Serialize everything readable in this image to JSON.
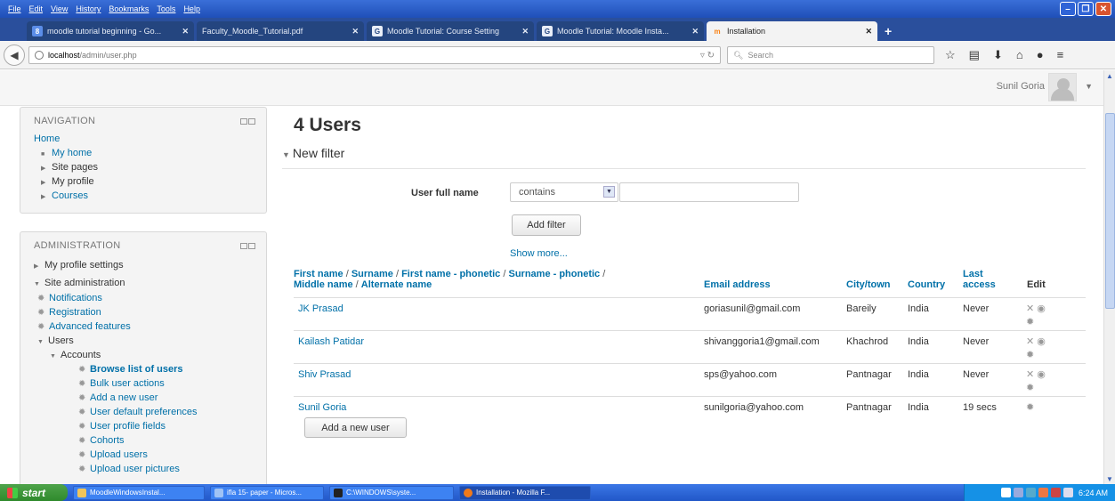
{
  "browser": {
    "menu": [
      "File",
      "Edit",
      "View",
      "History",
      "Bookmarks",
      "Tools",
      "Help"
    ],
    "tabs": [
      {
        "title": "moodle tutorial beginning - Go...",
        "icon": "google-icon",
        "icon_color": "#5b8de8",
        "active": false
      },
      {
        "title": "Faculty_Moodle_Tutorial.pdf",
        "icon": "pdf-icon",
        "icon_color": "#24457f",
        "active": false
      },
      {
        "title": "Moodle Tutorial: Course Setting",
        "icon": "g-icon",
        "icon_color": "#f3f3f3",
        "active": false
      },
      {
        "title": "Moodle Tutorial: Moodle Insta...",
        "icon": "g-icon",
        "icon_color": "#f3f3f3",
        "active": false
      },
      {
        "title": "Installation",
        "icon": "moodle-icon",
        "icon_color": "#f98012",
        "active": true
      }
    ],
    "url_host": "localhost",
    "url_path": "/admin/user.php",
    "search_placeholder": "Search"
  },
  "header": {
    "user_name": "Sunil Goria"
  },
  "navigation": {
    "title": "NAVIGATION",
    "home": "Home",
    "items": [
      "My home",
      "Site pages",
      "My profile",
      "Courses"
    ]
  },
  "administration": {
    "title": "ADMINISTRATION",
    "my_profile_settings": "My profile settings",
    "site_administration": "Site administration",
    "notifications": "Notifications",
    "registration": "Registration",
    "advanced_features": "Advanced features",
    "users": "Users",
    "accounts": "Accounts",
    "account_items": [
      "Browse list of users",
      "Bulk user actions",
      "Add a new user",
      "User default preferences",
      "User profile fields",
      "Cohorts",
      "Upload users",
      "Upload user pictures"
    ]
  },
  "main": {
    "title": "4 Users",
    "filter_header": "New filter",
    "filter_label": "User full name",
    "filter_operator": "contains",
    "filter_value": "",
    "add_filter_label": "Add filter",
    "show_more": "Show more...",
    "add_new_user_label": "Add a new user",
    "columns": {
      "name_parts": [
        "First name",
        "Surname",
        "First name - phonetic",
        "Surname - phonetic",
        "Middle name",
        "Alternate name"
      ],
      "email": "Email address",
      "city": "City/town",
      "country": "Country",
      "last_access_1": "Last",
      "last_access_2": "access",
      "edit": "Edit"
    },
    "users": [
      {
        "name": "JK Prasad",
        "email": "goriasunil@gmail.com",
        "city": "Bareily",
        "country": "India",
        "last_access": "Never"
      },
      {
        "name": "Kailash Patidar",
        "email": "shivanggoria1@gmail.com",
        "city": "Khachrod",
        "country": "India",
        "last_access": "Never"
      },
      {
        "name": "Shiv Prasad",
        "email": "sps@yahoo.com",
        "city": "Pantnagar",
        "country": "India",
        "last_access": "Never"
      },
      {
        "name": "Sunil Goria",
        "email": "sunilgoria@yahoo.com",
        "city": "Pantnagar",
        "country": "India",
        "last_access": "19 secs"
      }
    ]
  },
  "taskbar": {
    "start": "start",
    "tasks": [
      "MoodleWindowsInstal...",
      "ifla 15- paper - Micros...",
      "C:\\WINDOWS\\syste...",
      "Installation - Mozilla F..."
    ],
    "clock": "6:24 AM"
  }
}
